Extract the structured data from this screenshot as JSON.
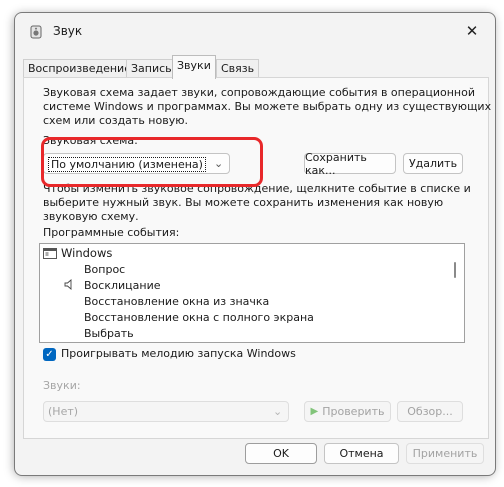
{
  "window": {
    "title": "Звук",
    "close_glyph": "✕"
  },
  "tabs": [
    {
      "label": "Воспроизведение",
      "active": false
    },
    {
      "label": "Запись",
      "active": false
    },
    {
      "label": "Звуки",
      "active": true
    },
    {
      "label": "Связь",
      "active": false
    }
  ],
  "description": [
    "Звуковая схема задает звуки, сопровождающие события в операционной",
    "системе Windows и программах. Вы можете выбрать одну из существующих",
    "схем или создать новую."
  ],
  "scheme": {
    "label": "Звуковая схема:",
    "value": "По умолчанию (изменена)",
    "save_button": "Сохранить как...",
    "delete_button": "Удалить"
  },
  "instructions": [
    "Чтобы изменить звуковое сопровождение, щелкните событие в списке и",
    "выберите нужный звук. Вы можете сохранить изменения как новую",
    "звуковую схему."
  ],
  "events": {
    "label": "Программные события:",
    "group": "Windows",
    "items": [
      {
        "label": "Вопрос",
        "has_sound": false
      },
      {
        "label": "Восклицание",
        "has_sound": true
      },
      {
        "label": "Восстановление окна из значка",
        "has_sound": false
      },
      {
        "label": "Восстановление окна с полного экрана",
        "has_sound": false
      },
      {
        "label": "Выбрать",
        "has_sound": false
      }
    ]
  },
  "startup": {
    "label": "Проигрывать мелодию запуска Windows",
    "checked": true
  },
  "sounds": {
    "label": "Звуки:",
    "value": "(Нет)",
    "test_button": "Проверить",
    "browse_button": "Обзор..."
  },
  "footer": {
    "ok": "OK",
    "cancel": "Отмена",
    "apply": "Применить"
  },
  "colors": {
    "accent": "#0067c0",
    "highlight_ring": "#e8282a"
  }
}
